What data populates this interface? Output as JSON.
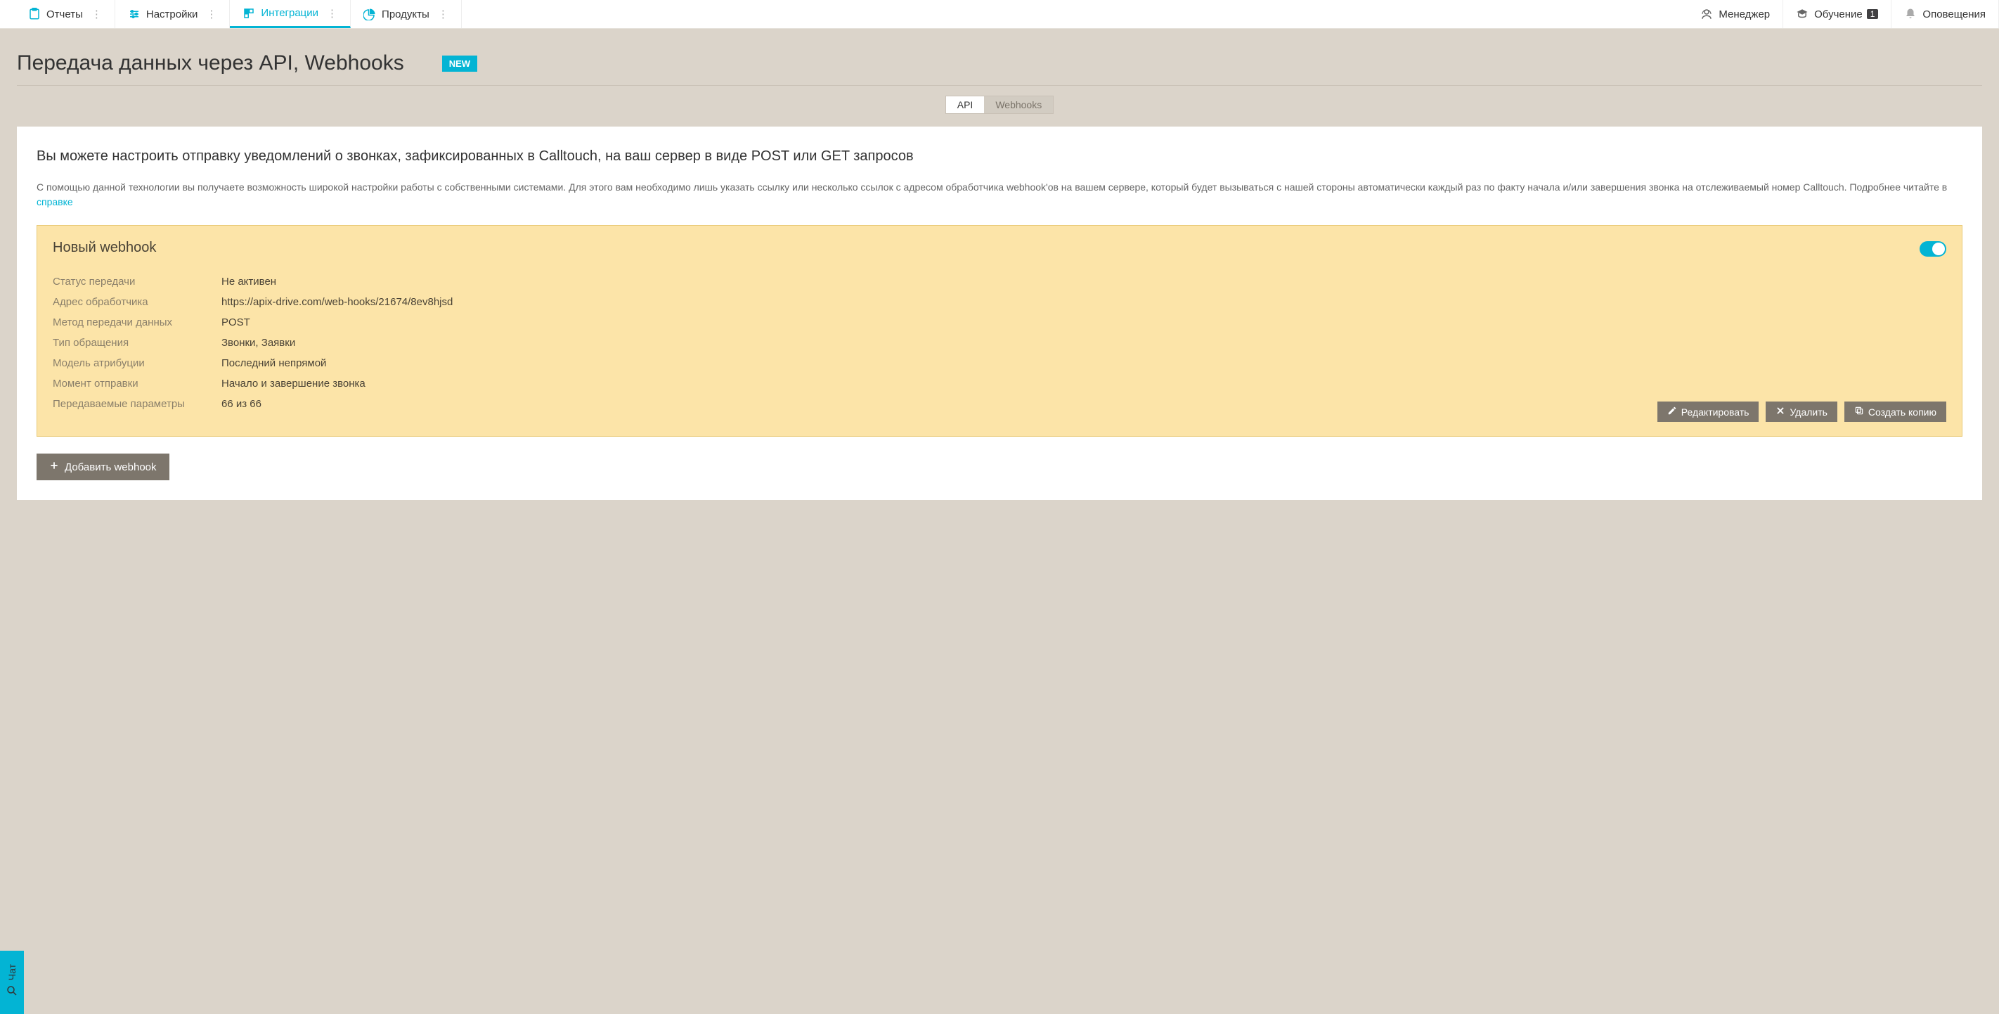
{
  "nav": {
    "left": [
      {
        "label": "Отчеты",
        "icon": "reports"
      },
      {
        "label": "Настройки",
        "icon": "settings"
      },
      {
        "label": "Интеграции",
        "icon": "integrations",
        "active": true
      },
      {
        "label": "Продукты",
        "icon": "products"
      }
    ],
    "right": [
      {
        "label": "Менеджер",
        "icon": "manager"
      },
      {
        "label": "Обучение",
        "icon": "training",
        "badge": "1"
      },
      {
        "label": "Оповещения",
        "icon": "bell"
      }
    ]
  },
  "header": {
    "title": "Передача данных через API, Webhooks",
    "new_badge": "NEW"
  },
  "subtabs": {
    "api": "API",
    "webhooks": "Webhooks"
  },
  "panel": {
    "heading": "Вы можете настроить отправку уведомлений о звонках, зафиксированных в Calltouch, на ваш сервер в виде POST или GET запросов",
    "desc_1": "С помощью данной технологии вы получаете возможность широкой настройки работы с собственными системами. Для этого вам необходимо лишь указать ссылку или несколько ссылок с адресом обработчика webhook'ов на вашем сервере, который будет вызываться с нашей стороны автоматически каждый раз по факту начала и/или завершения звонка на отслеживаемый номер Calltouch. Подробнее читайте в ",
    "desc_link": "справке"
  },
  "webhook": {
    "title": "Новый webhook",
    "rows": [
      {
        "label": "Статус передачи",
        "value": "Не активен"
      },
      {
        "label": "Адрес обработчика",
        "value": "https://apix-drive.com/web-hooks/21674/8ev8hjsd"
      },
      {
        "label": "Метод передачи данных",
        "value": "POST"
      },
      {
        "label": "Тип обращения",
        "value": "Звонки, Заявки"
      },
      {
        "label": "Модель атрибуции",
        "value": "Последний непрямой"
      },
      {
        "label": "Момент отправки",
        "value": "Начало и завершение звонка"
      },
      {
        "label": "Передаваемые параметры",
        "value": "66 из 66"
      }
    ],
    "actions": {
      "edit": "Редактировать",
      "delete": "Удалить",
      "copy": "Создать копию"
    }
  },
  "add_btn": "Добавить webhook",
  "chat": "Чат"
}
